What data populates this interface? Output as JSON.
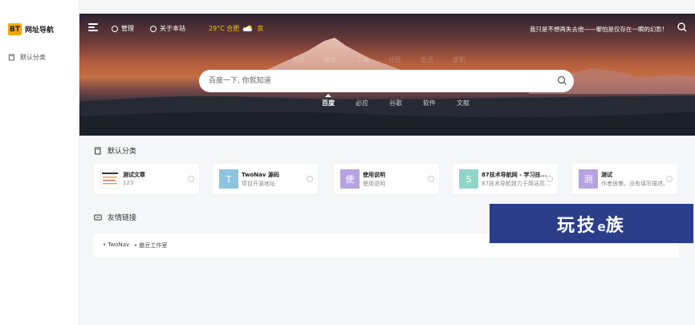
{
  "brand": {
    "logo": "BT",
    "name": "网址导航"
  },
  "sidebar": {
    "items": [
      {
        "label": "默认分类",
        "icon": "book-icon"
      }
    ]
  },
  "topbar": {
    "nav": [
      {
        "label": "管理",
        "icon": "user-icon"
      },
      {
        "label": "关于本站",
        "icon": "github-icon"
      }
    ],
    "weather": {
      "text": "29°C 合肥",
      "quality": "良"
    },
    "slogan": "我只是不想再失去他——哪怕是仅存在一瞬的幻影!"
  },
  "hero": {
    "faint_tabs": [
      "常用",
      "搜索",
      "工具",
      "社区",
      "生活",
      "求职"
    ],
    "search_placeholder": "百度一下, 你就知道",
    "engines": [
      "百度",
      "必应",
      "谷歌",
      "软件",
      "文献"
    ],
    "active_engine": 0
  },
  "sections": {
    "default": {
      "title": "默认分类",
      "cards": [
        {
          "title": "测试文章",
          "desc": "123",
          "thumb": "",
          "color": "#ffffff"
        },
        {
          "title": "TwoNav 源码",
          "desc": "项目开源地址",
          "thumb": "T",
          "color": "#8cc4e0"
        },
        {
          "title": "使用说明",
          "desc": "使用说明",
          "thumb": "使",
          "color": "#b7a3e0"
        },
        {
          "title": "87技术导航网 - 学习技...",
          "desc": "87技术导航致力于简洁高...",
          "thumb": "S",
          "color": "#8fd6c9"
        },
        {
          "title": "测试",
          "desc": "作者很懒，没有填写描述。",
          "thumb": "测",
          "color": "#b7a3e0"
        }
      ]
    },
    "links": {
      "title": "友情链接",
      "items": [
        "TwoNav",
        "憨豆工作室"
      ]
    }
  },
  "banner": {
    "text": "玩技",
    "e": "e",
    "tail": "族"
  }
}
